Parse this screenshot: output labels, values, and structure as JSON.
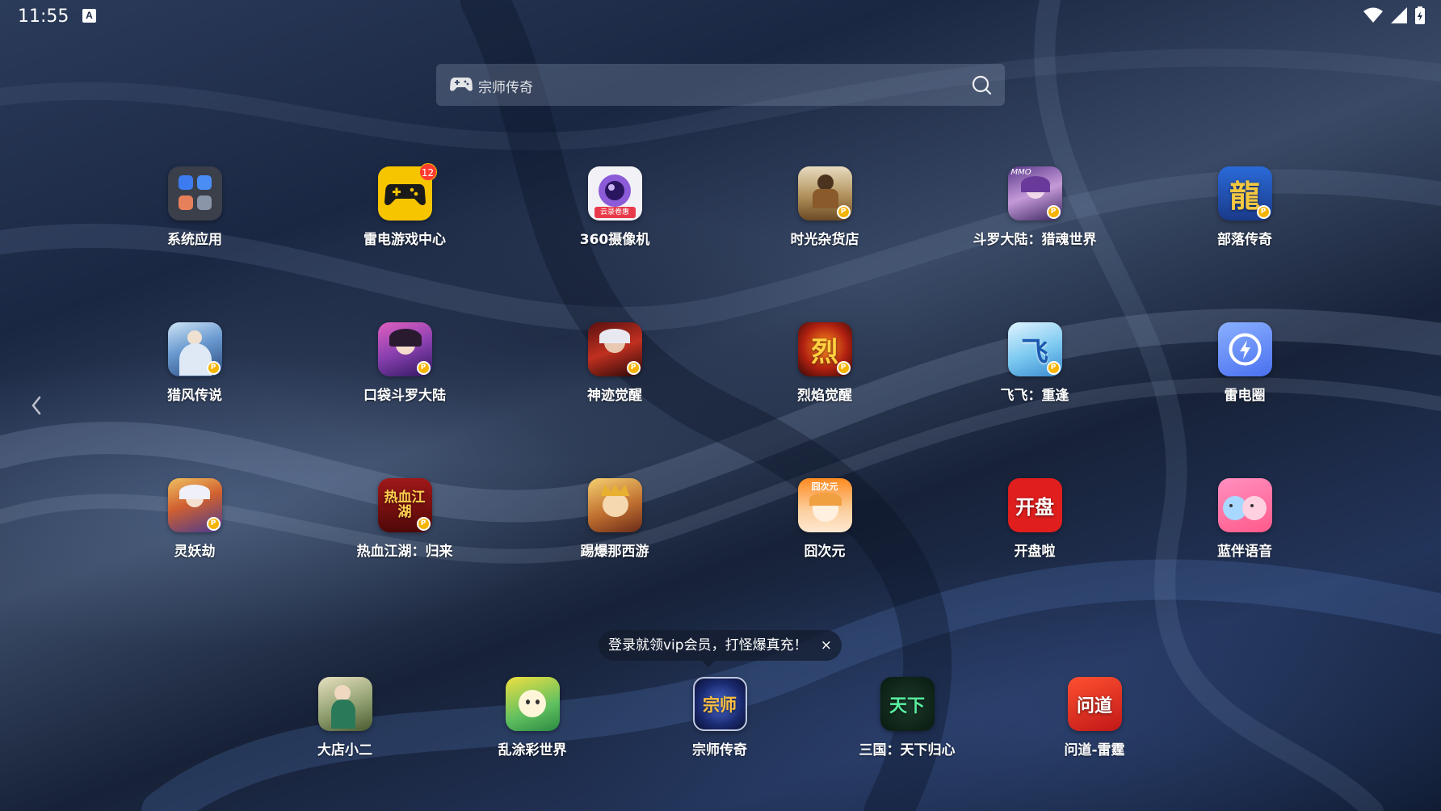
{
  "status_bar": {
    "time": "11:55",
    "notification_icon": "A"
  },
  "search": {
    "text": "宗师传奇"
  },
  "apps": [
    {
      "label": "系统应用",
      "icon": "folder-icon"
    },
    {
      "label": "雷电游戏中心",
      "icon": "gamepad-icon",
      "badge": "12"
    },
    {
      "label": "360摄像机",
      "icon": "camera-icon",
      "tag": "云录卷惠"
    },
    {
      "label": "时光杂货店",
      "icon": "shop-game-icon"
    },
    {
      "label": "斗罗大陆：猎魂世界",
      "icon": "douluo-icon",
      "tag": "MMO"
    },
    {
      "label": "部落传奇",
      "icon": "dragon-icon",
      "glyph": "龍"
    },
    {
      "label": "猎风传说",
      "icon": "hunter-icon"
    },
    {
      "label": "口袋斗罗大陆",
      "icon": "pocket-douluo-icon"
    },
    {
      "label": "神迹觉醒",
      "icon": "miracle-icon"
    },
    {
      "label": "烈焰觉醒",
      "icon": "flame-icon",
      "glyph": "烈"
    },
    {
      "label": "飞飞：重逢",
      "icon": "feifei-icon",
      "glyph": "飞"
    },
    {
      "label": "雷电圈",
      "icon": "lightning-circle-icon"
    },
    {
      "label": "灵妖劫",
      "icon": "spirit-icon"
    },
    {
      "label": "热血江湖：归来",
      "icon": "jianghu-icon",
      "glyph": "热血江湖"
    },
    {
      "label": "踢爆那西游",
      "icon": "xiyou-icon"
    },
    {
      "label": "囧次元",
      "icon": "jiong-icon",
      "tag": "囧次元"
    },
    {
      "label": "开盘啦",
      "icon": "kaipan-icon",
      "glyph": "开盘"
    },
    {
      "label": "蓝伴语音",
      "icon": "voice-icon"
    }
  ],
  "dock": [
    {
      "label": "大店小二",
      "icon": "shop-girl-icon"
    },
    {
      "label": "乱涂彩世界",
      "icon": "doodle-icon"
    },
    {
      "label": "宗师传奇",
      "icon": "zongshi-icon",
      "glyph": "宗师"
    },
    {
      "label": "三国：天下归心",
      "icon": "sanguo-icon",
      "glyph": "天下"
    },
    {
      "label": "问道-雷霆",
      "icon": "wendao-icon",
      "glyph": "问道"
    }
  ],
  "tooltip": {
    "text": "登录就领vip会员，打怪爆真充！",
    "close": "×"
  },
  "colors": {
    "coin": "#f5b400",
    "badge": "#ff3b30"
  }
}
